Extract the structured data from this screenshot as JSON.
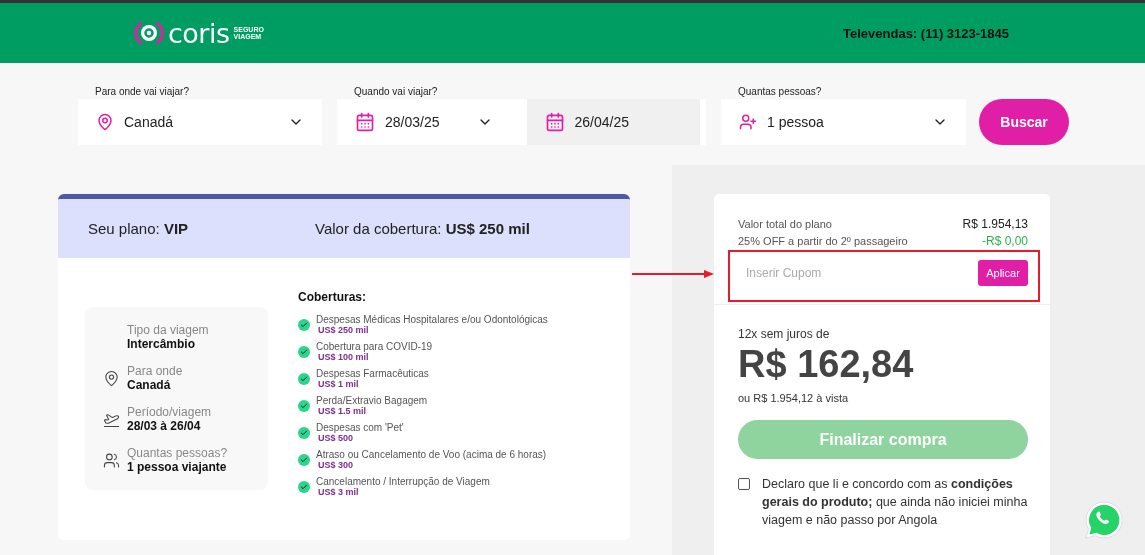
{
  "header": {
    "logo": "coris",
    "logo_tagline_1": "SEGURO",
    "logo_tagline_2": "VIAGEM",
    "phone": "Televendas: (11) 3123-1845"
  },
  "search": {
    "destination": {
      "label": "Para onde vai viajar?",
      "value": "Canadá"
    },
    "dates": {
      "label": "Quando vai viajar?",
      "start": "28/03/25",
      "end": "26/04/25"
    },
    "people": {
      "label": "Quantas pessoas?",
      "value": "1 pessoa"
    },
    "button": "Buscar"
  },
  "plan": {
    "name_label": "Seu plano:",
    "name": "VIP",
    "coverage_label": "Valor da cobertura:",
    "coverage": "US$ 250 mil",
    "trip_info": [
      {
        "kind": "none",
        "label": "Tipo da viagem",
        "value": "Intercâmbio"
      },
      {
        "kind": "pin",
        "label": "Para onde",
        "value": "Canadá"
      },
      {
        "kind": "plane",
        "label": "Período/viagem",
        "value": "28/03 à 26/04"
      },
      {
        "kind": "people",
        "label": "Quantas pessoas?",
        "value": "1 pessoa viajante"
      }
    ],
    "coverages_title": "Coberturas:",
    "coverages": [
      {
        "name": "Despesas Médicas Hospitalares e/ou Odontológicas",
        "amount": "US$ 250 mil"
      },
      {
        "name": "Cobertura para COVID-19",
        "amount": "US$ 100 mil"
      },
      {
        "name": "Despesas Farmacêuticas",
        "amount": "US$ 1 mil"
      },
      {
        "name": "Perda/Extravio Bagagem",
        "amount": "US$ 1.5 mil"
      },
      {
        "name": "Despesas com 'Pet'",
        "amount": "US$ 500"
      },
      {
        "name": "Atraso ou Cancelamento de Voo (acima de 6 horas)",
        "amount": "US$ 300"
      },
      {
        "name": "Cancelamento / Interrupção de Viagem",
        "amount": "US$ 3 mil"
      }
    ]
  },
  "summary": {
    "total_label": "Valor total do plano",
    "total": "R$ 1.954,13",
    "discount_label": "25% OFF a partir do 2º passageiro",
    "discount": "-R$ 0,00",
    "coupon": {
      "placeholder": "Inserir Cupom",
      "button": "Aplicar"
    },
    "installments_label": "12x sem juros de",
    "installment": "R$ 162,84",
    "cash": "ou R$ 1.954,12 à vista",
    "checkout": {
      "label": "Finalizar compra",
      "disabled": true
    },
    "terms": {
      "checked": false,
      "text": "Declaro que li e concordo com as **condições gerais do produto;** que ainda não iniciei minha viagem e não passo por Angola"
    }
  }
}
